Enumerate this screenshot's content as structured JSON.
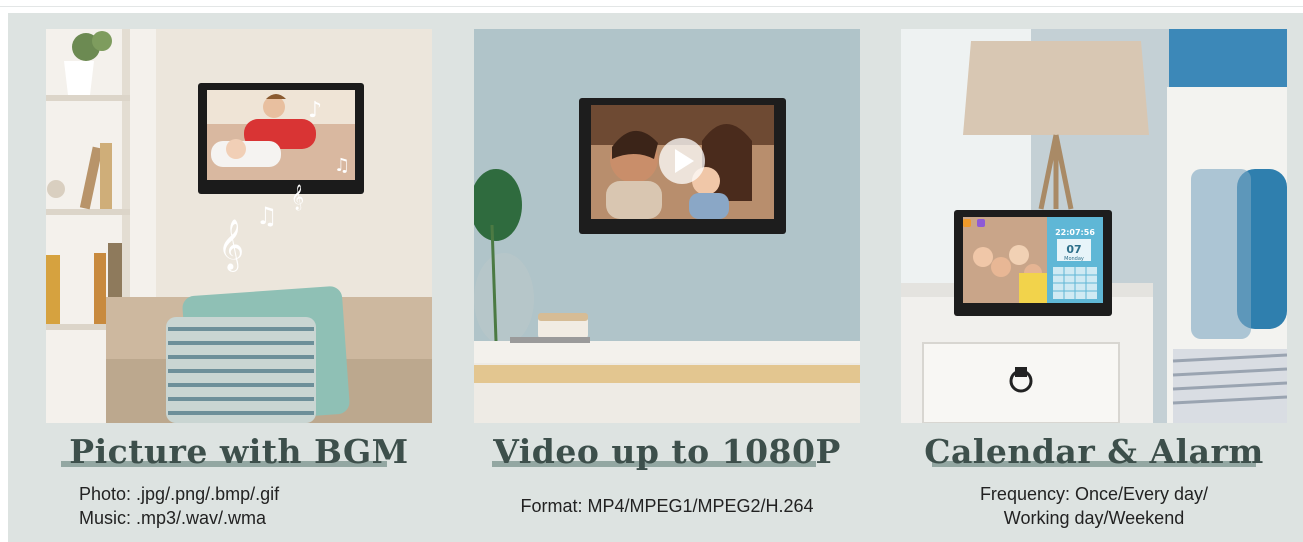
{
  "features": [
    {
      "title": "Picture with BGM",
      "lines": [
        "Photo: .jpg/.png/.bmp/.gif",
        "Music: .mp3/.wav/.wma"
      ]
    },
    {
      "title": "Video up to 1080P",
      "lines": [
        "Format: MP4/MPEG1/MPEG2/H.264"
      ]
    },
    {
      "title": "Calendar & Alarm",
      "lines": [
        "Frequency: Once/Every day/",
        "Working day/Weekend"
      ]
    }
  ],
  "calendar_widget": {
    "time": "22:07:56",
    "day": "07",
    "weekday": "Monday"
  },
  "colors": {
    "panel": "#dde3e1",
    "title": "#3d4f4b",
    "title_bar": "#93a7a2"
  }
}
